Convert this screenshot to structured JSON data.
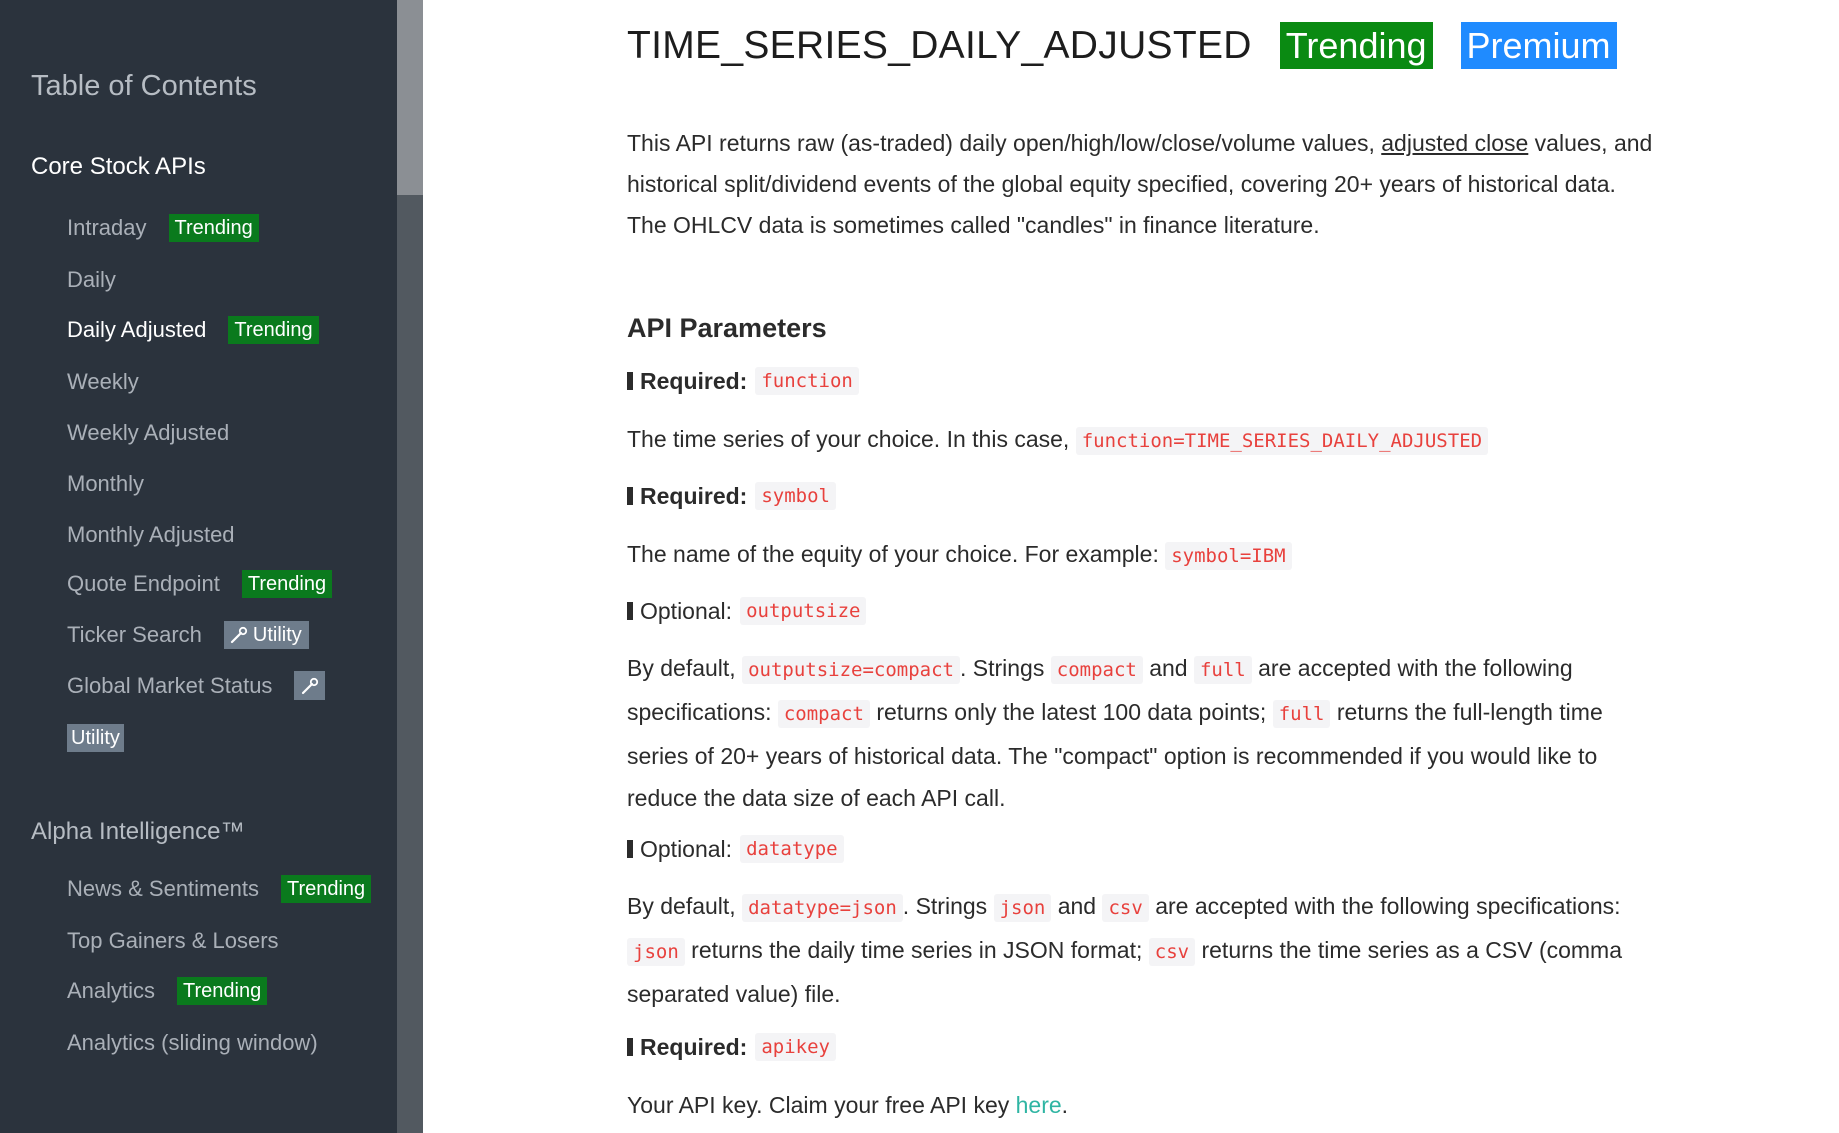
{
  "sidebar": {
    "toc_title": "Table of Contents",
    "sections": [
      {
        "title": "Core Stock APIs",
        "items": [
          {
            "label": "Intraday",
            "badge": "Trending"
          },
          {
            "label": "Daily"
          },
          {
            "label": "Daily Adjusted",
            "badge": "Trending"
          },
          {
            "label": "Weekly"
          },
          {
            "label": "Weekly Adjusted"
          },
          {
            "label": "Monthly"
          },
          {
            "label": "Monthly Adjusted"
          },
          {
            "label": "Quote Endpoint",
            "badge": "Trending"
          },
          {
            "label": "Ticker Search",
            "badge": "Utility"
          },
          {
            "label": "Global Market Status",
            "badge": "Utility"
          }
        ]
      },
      {
        "title": "Alpha Intelligence™",
        "items": [
          {
            "label": "News & Sentiments",
            "badge": "Trending"
          },
          {
            "label": "Top Gainers & Losers"
          },
          {
            "label": "Analytics",
            "badge": "Trending"
          },
          {
            "label": "Analytics (sliding window)"
          }
        ]
      }
    ]
  },
  "main": {
    "title": "TIME_SERIES_DAILY_ADJUSTED",
    "title_badges": [
      "Trending",
      "Premium"
    ],
    "intro": {
      "part1": "This API returns raw (as-traded) daily open/high/low/close/volume values, ",
      "link": "adjusted close",
      "part2": " values, and historical split/dividend events of the global equity specified, covering 20+ years of historical data. The OHLCV data is sometimes called \"candles\" in finance literature."
    },
    "params_heading": "API Parameters",
    "params": [
      {
        "kind": "Required:",
        "name": "function",
        "desc": {
          "t1": "The time series of your choice. In this case, ",
          "c1": "function=TIME_SERIES_DAILY_ADJUSTED"
        }
      },
      {
        "kind": "Required:",
        "name": "symbol",
        "desc": {
          "t1": "The name of the equity of your choice. For example: ",
          "c1": "symbol=IBM"
        }
      },
      {
        "kind": "Optional:",
        "name": "outputsize",
        "desc": {
          "t1": "By default, ",
          "c1": "outputsize=compact",
          "t2": ". Strings ",
          "c2": "compact",
          "t3": " and ",
          "c3": "full",
          "t4": " are accepted with the following specifications: ",
          "c4": "compact",
          "t5": " returns only the latest 100 data points; ",
          "c5": "full",
          "t6": " returns the full-length time series of 20+ years of historical data. The \"compact\" option is recommended if you would like to reduce the data size of each API call."
        }
      },
      {
        "kind": "Optional:",
        "name": "datatype",
        "desc": {
          "t1": "By default, ",
          "c1": "datatype=json",
          "t2": ". Strings ",
          "c2": "json",
          "t3": " and ",
          "c3": "csv",
          "t4": " are accepted with the following specifications: ",
          "c4": "json",
          "t5": " returns the daily time series in JSON format; ",
          "c5": "csv",
          "t6": " returns the time series as a CSV (comma separated value) file."
        }
      },
      {
        "kind": "Required:",
        "name": "apikey",
        "desc": {
          "t1": "Your API key. Claim your free API key ",
          "link": "here",
          "t2": "."
        }
      }
    ]
  },
  "colors": {
    "sidebar_bg": "#2b333d",
    "trending_badge": "#0a7a1d",
    "premium_badge": "#1f8bff",
    "utility_badge": "#6e7c8b",
    "code_text": "#e8413d",
    "link": "#2fb5a3"
  }
}
